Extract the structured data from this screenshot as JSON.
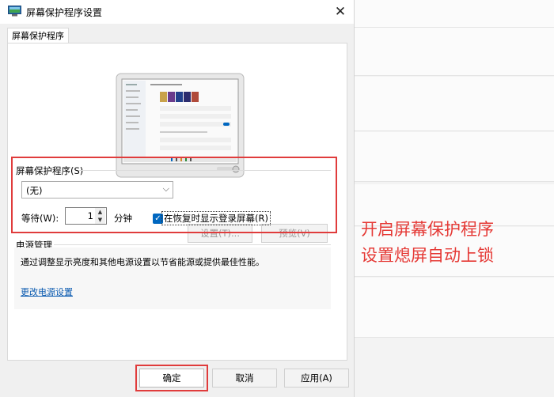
{
  "window": {
    "title": "屏幕保护程序设置",
    "close_glyph": "✕"
  },
  "tab": {
    "label": "屏幕保护程序"
  },
  "screensaver": {
    "section_label": "屏幕保护程序(S)",
    "selected": "(无)",
    "settings_button": "设置(T)...",
    "preview_button": "预览(V)",
    "wait_label": "等待(W):",
    "wait_value": "1",
    "minutes_label": "分钟",
    "resume_checkbox_label": "在恢复时显示登录屏幕(R)",
    "resume_checked": true
  },
  "power": {
    "section_label": "电源管理",
    "description": "通过调整显示亮度和其他电源设置以节省能源或提供最佳性能。",
    "link": "更改电源设置"
  },
  "buttons": {
    "ok": "确定",
    "cancel": "取消",
    "apply": "应用(A)"
  },
  "annotation": {
    "line1": "开启屏幕保护程序",
    "line2": "设置熄屏自动上锁"
  },
  "colors": {
    "highlight": "#e03c3c",
    "annotation_text": "#e53935",
    "checkbox": "#0067c0"
  }
}
